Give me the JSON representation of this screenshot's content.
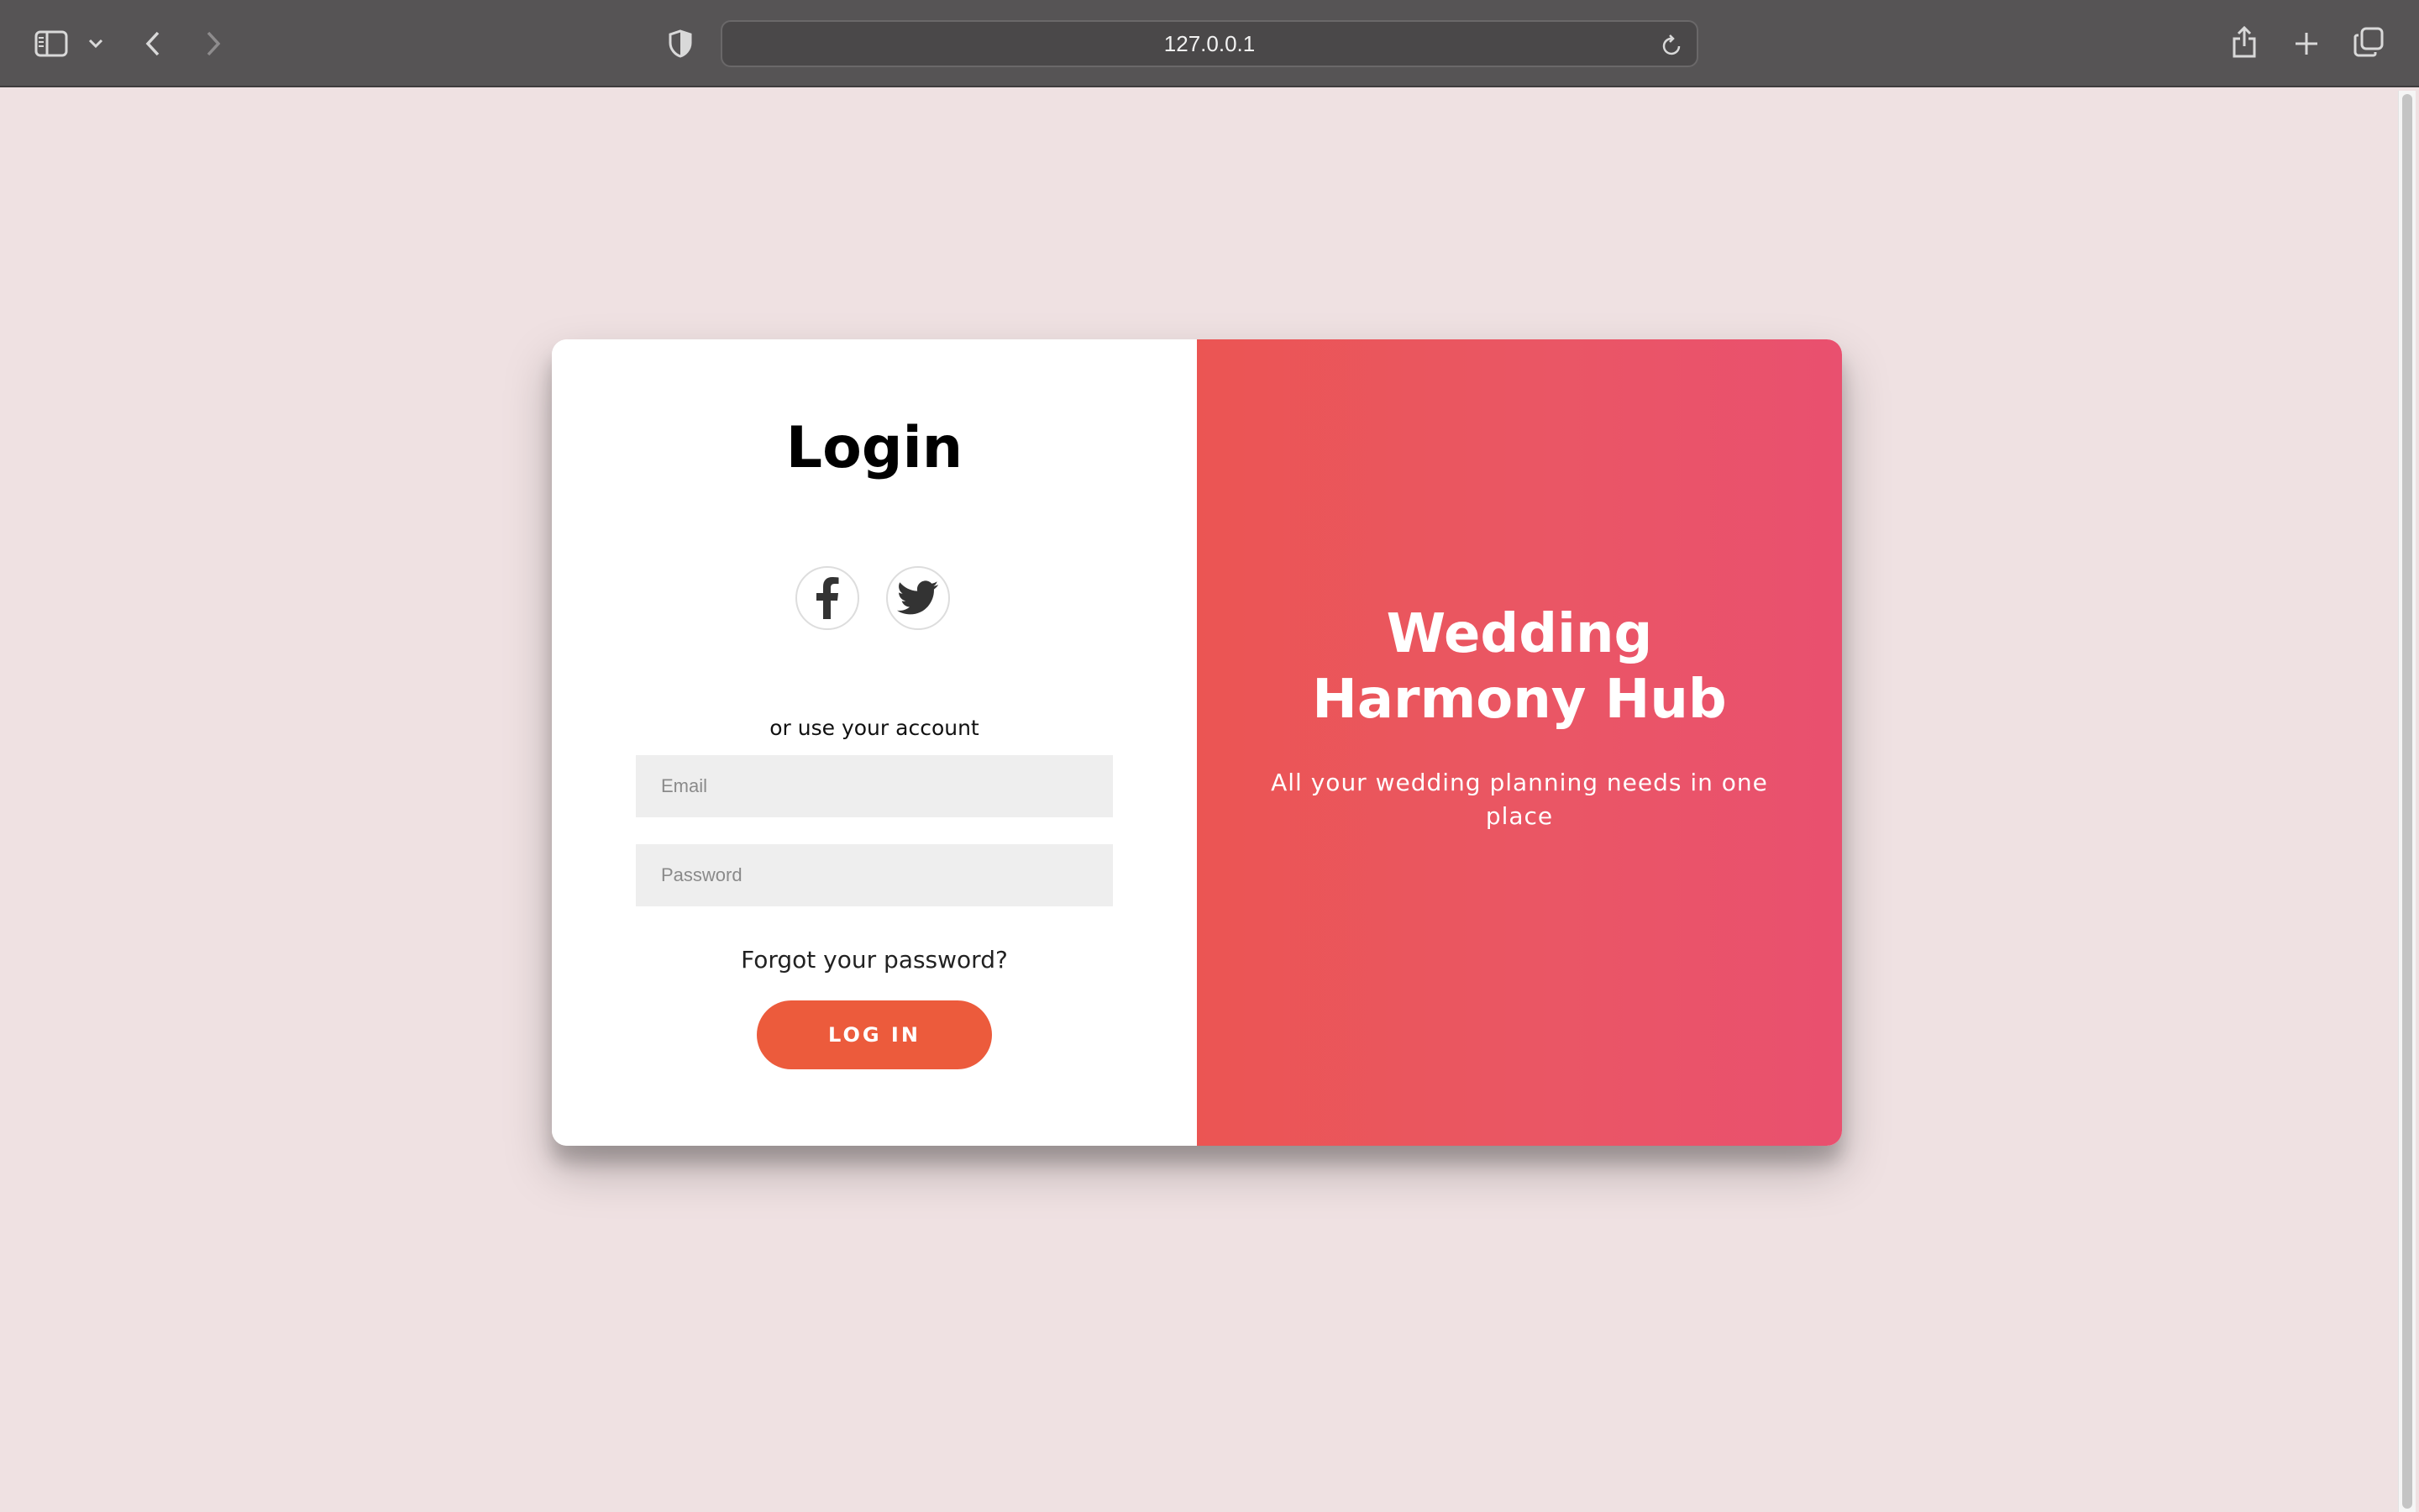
{
  "browser": {
    "url": "127.0.0.1",
    "icons": [
      "sidebar-icon",
      "chevron-down-icon",
      "back-icon",
      "forward-icon",
      "shield-icon",
      "reload-icon",
      "share-icon",
      "new-tab-icon",
      "tabs-overview-icon"
    ]
  },
  "login": {
    "title": "Login",
    "social": [
      "facebook-icon",
      "twitter-icon"
    ],
    "alt_text": "or use your account",
    "email_placeholder": "Email",
    "password_placeholder": "Password",
    "forgot": "Forgot your password?",
    "button": "LOG IN"
  },
  "hero": {
    "title_line1": "Wedding",
    "title_line2": "Harmony Hub",
    "subtitle_line1": "All your wedding planning needs in one",
    "subtitle_line2": "place"
  },
  "colors": {
    "page_background": "#efe1e2",
    "accent_button": "#ec5b3c",
    "hero_gradient_start": "#eb5553",
    "hero_gradient_end": "#e9506f"
  }
}
